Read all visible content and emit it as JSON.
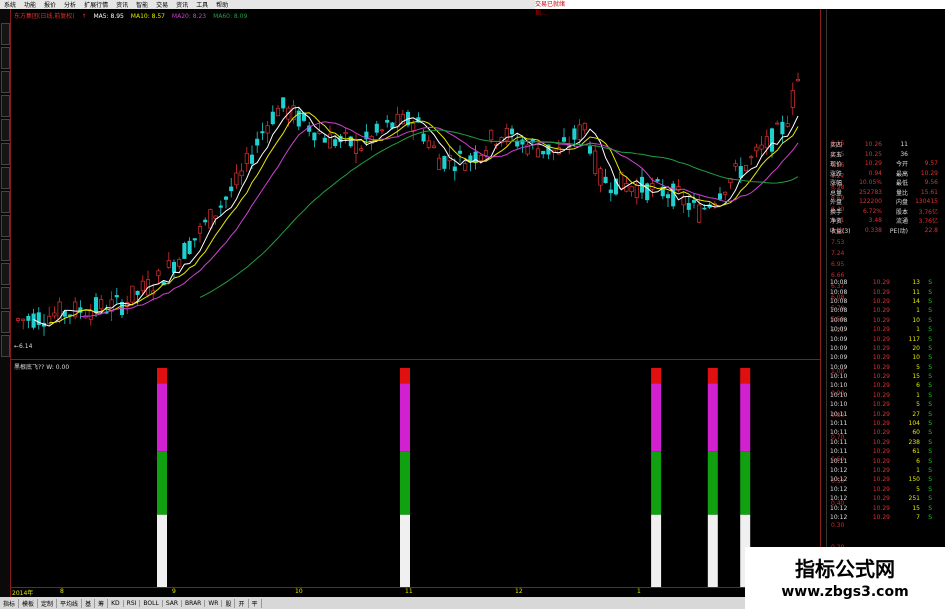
{
  "menu": [
    "系统",
    "功能",
    "报价",
    "分析",
    "扩展行情",
    "资讯",
    "智能",
    "交易",
    "资讯",
    "工具",
    "帮助"
  ],
  "menu_brand": "交易已就绪 指…",
  "title": {
    "name": "东方集团(日线,前复权)",
    "arrow": "↑",
    "ma5": "MA5: 8.95",
    "ma10": "MA10: 8.57",
    "ma20": "MA20: 8.23",
    "ma60": "MA60: 8.09"
  },
  "indicator_label": "黑根底飞??  W: 0.00",
  "price_axis": [
    "8.15",
    "9.85",
    "9.56",
    "9.27",
    "8.98",
    "8.69",
    "8.40",
    "8.11",
    "7.82",
    "7.53",
    "7.24",
    "6.95",
    "6.66",
    "6.37",
    "6.08",
    "5.79",
    "5.50",
    "5.21"
  ],
  "ind_axis": [
    "1.00",
    "0.90",
    "0.80",
    "0.70",
    "0.60",
    "0.50",
    "0.40",
    "0.30",
    "0.20",
    "0.10"
  ],
  "quote": [
    [
      "买四",
      "10.26",
      "11",
      ""
    ],
    [
      "买五",
      "10.25",
      "36",
      ""
    ],
    [
      "现价",
      "10.29",
      "今开",
      "9.57"
    ],
    [
      "涨跌",
      "0.94",
      "最高",
      "10.29"
    ],
    [
      "涨幅",
      "10.05%",
      "最低",
      "9.56"
    ],
    [
      "总量",
      "252783",
      "量比",
      "15.61"
    ],
    [
      "外盘",
      "122200",
      "内盘",
      "130415"
    ],
    [
      "换手",
      "6.72%",
      "股本",
      "3.76亿"
    ],
    [
      "净资",
      "3.48",
      "流通",
      "3.76亿"
    ],
    [
      "收益(3)",
      "0.338",
      "PE(动)",
      "22.8"
    ]
  ],
  "ticks": [
    [
      "10:08",
      "10.29",
      "13",
      "S"
    ],
    [
      "10:08",
      "10.29",
      "11",
      "S"
    ],
    [
      "10:08",
      "10.29",
      "14",
      "S"
    ],
    [
      "10:08",
      "10.29",
      "1",
      "S"
    ],
    [
      "10:08",
      "10.29",
      "10",
      "S"
    ],
    [
      "10:09",
      "10.29",
      "1",
      "S"
    ],
    [
      "10:09",
      "10.29",
      "117",
      "S"
    ],
    [
      "10:09",
      "10.29",
      "20",
      "S"
    ],
    [
      "10:09",
      "10.29",
      "10",
      "S"
    ],
    [
      "10:09",
      "10.29",
      "5",
      "S"
    ],
    [
      "10:10",
      "10.29",
      "15",
      "S"
    ],
    [
      "10:10",
      "10.29",
      "6",
      "S"
    ],
    [
      "10:10",
      "10.29",
      "1",
      "S"
    ],
    [
      "10:10",
      "10.29",
      "5",
      "S"
    ],
    [
      "10:11",
      "10.29",
      "27",
      "S"
    ],
    [
      "10:11",
      "10.29",
      "104",
      "S"
    ],
    [
      "10:11",
      "10.29",
      "60",
      "S"
    ],
    [
      "10:11",
      "10.29",
      "238",
      "S"
    ],
    [
      "10:11",
      "10.29",
      "61",
      "S"
    ],
    [
      "10:11",
      "10.29",
      "6",
      "S"
    ],
    [
      "10:12",
      "10.29",
      "1",
      "S"
    ],
    [
      "10:12",
      "10.29",
      "150",
      "S"
    ],
    [
      "10:12",
      "10.29",
      "5",
      "S"
    ],
    [
      "10:12",
      "10.29",
      "251",
      "S"
    ],
    [
      "10:12",
      "10.29",
      "15",
      "S"
    ],
    [
      "10:12",
      "10.29",
      "7",
      "S"
    ]
  ],
  "dates": [
    "2014年",
    "8",
    "9",
    "10",
    "11",
    "12",
    "1",
    "2",
    "3"
  ],
  "bottom_tabs": [
    "指标",
    "模板",
    "定制",
    "平均线",
    "基",
    "筹",
    "KD",
    "RSI",
    "BOLL",
    "SAR",
    "BRAR",
    "WR",
    "股",
    "开",
    "平"
  ],
  "low_label": "←6.14",
  "watermark": {
    "line1": "指标公式网",
    "line2": "www.zbgs3.com"
  },
  "colors": {
    "up": "#e03030",
    "down": "#20d0d0",
    "ma5": "#ffffff",
    "ma10": "#e8e800",
    "ma20": "#d040d0",
    "ma60": "#20a040",
    "grid": "#8a1a1a"
  },
  "indicator_bars": [
    0.2,
    0.5,
    0.81,
    0.88,
    0.92
  ]
}
